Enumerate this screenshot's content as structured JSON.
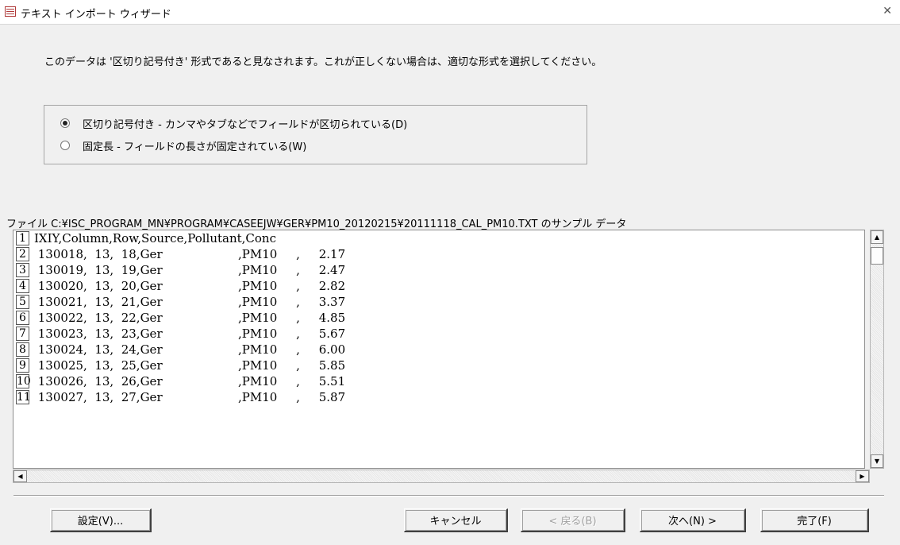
{
  "window": {
    "title": "テキスト インポート ウィザード"
  },
  "description": "このデータは '区切り記号付き' 形式であると見なされます。これが正しくない場合は、適切な形式を選択してください。",
  "options": [
    {
      "label": "区切り記号付き - カンマやタブなどでフィールドが区切られている(D)",
      "checked": true
    },
    {
      "label": "固定長 - フィールドの長さが固定されている(W)",
      "checked": false
    }
  ],
  "preview": {
    "file_label": "ファイル C:¥ISC_PROGRAM_MN¥PROGRAM¥CASEEJW¥GER¥PM10_20120215¥20111118_CAL_PM10.TXT のサンプル データ",
    "rows": [
      {
        "num": "1",
        "text": "IXIY,Column,Row,Source,Pollutant,Conc"
      },
      {
        "num": "2",
        "text": " 130018,  13,  18,Ger                    ,PM10     ,     2.17"
      },
      {
        "num": "3",
        "text": " 130019,  13,  19,Ger                    ,PM10     ,     2.47"
      },
      {
        "num": "4",
        "text": " 130020,  13,  20,Ger                    ,PM10     ,     2.82"
      },
      {
        "num": "5",
        "text": " 130021,  13,  21,Ger                    ,PM10     ,     3.37"
      },
      {
        "num": "6",
        "text": " 130022,  13,  22,Ger                    ,PM10     ,     4.85"
      },
      {
        "num": "7",
        "text": " 130023,  13,  23,Ger                    ,PM10     ,     5.67"
      },
      {
        "num": "8",
        "text": " 130024,  13,  24,Ger                    ,PM10     ,     6.00"
      },
      {
        "num": "9",
        "text": " 130025,  13,  25,Ger                    ,PM10     ,     5.85"
      },
      {
        "num": "10",
        "text": " 130026,  13,  26,Ger                    ,PM10     ,     5.51"
      },
      {
        "num": "11",
        "text": " 130027,  13,  27,Ger                    ,PM10     ,     5.87"
      }
    ]
  },
  "buttons": {
    "settings": "設定(V)...",
    "cancel": "キャンセル",
    "back": "< 戻る(B)",
    "next": "次へ(N) >",
    "finish": "完了(F)"
  }
}
